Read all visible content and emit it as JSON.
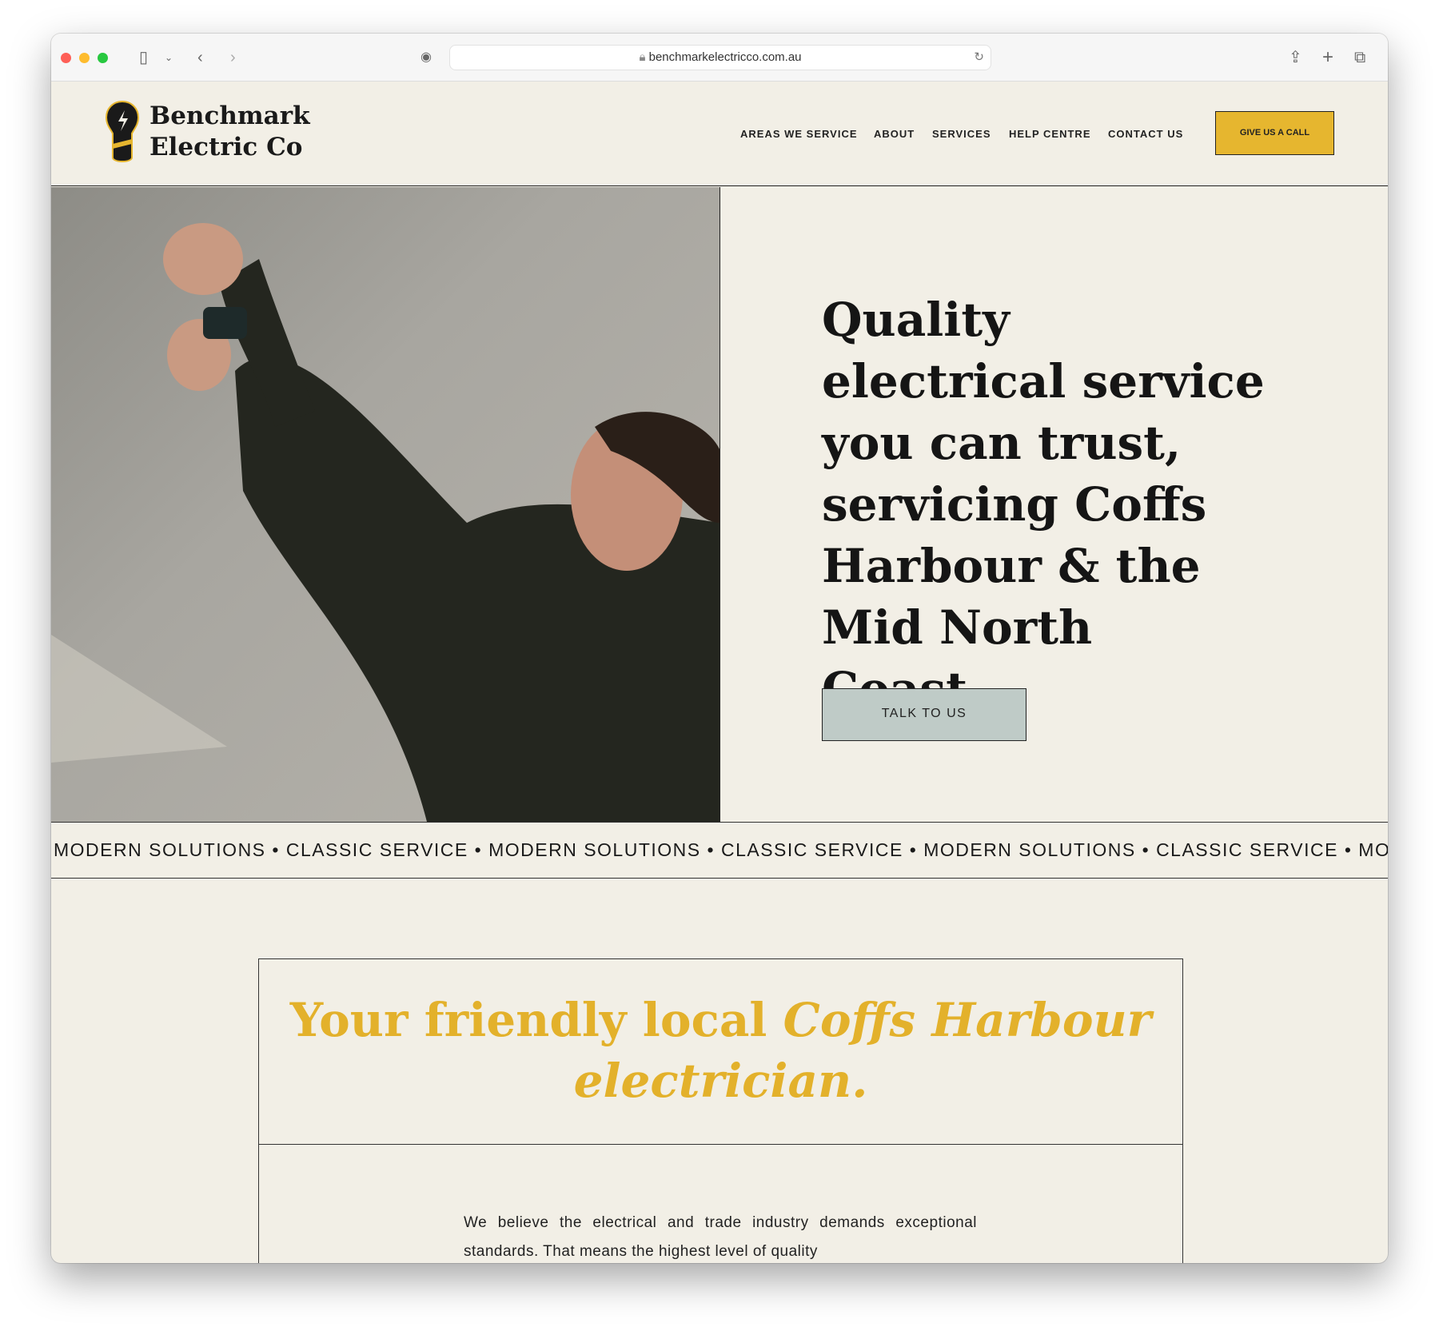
{
  "browser": {
    "url": "benchmarkelectricco.com.au"
  },
  "header": {
    "logo_line1": "Benchmark",
    "logo_line2": "Electric Co",
    "nav": [
      "AREAS WE SERVICE",
      "ABOUT",
      "SERVICES",
      "HELP CENTRE",
      "CONTACT US"
    ],
    "cta": "GIVE US A CALL"
  },
  "hero": {
    "headline": "Quality electrical service you can trust, servicing Coffs Harbour & the Mid North Coast.",
    "button": "TALK TO US"
  },
  "ticker": {
    "items": [
      "MODERN SOLUTIONS",
      "CLASSIC SERVICE",
      "MODERN SOLUTIONS",
      "CLASSIC SERVICE",
      "MODERN SOLUTIONS",
      "CLASSIC SERVICE",
      "MODERN SOLUTIONS"
    ]
  },
  "intro": {
    "title_plain": "Your friendly local ",
    "title_italic": "Coffs Harbour electrician.",
    "body": "We believe the electrical and trade industry demands exceptional standards. That means the highest level of quality"
  },
  "colors": {
    "accent": "#e6b62f",
    "background": "#f2efe6",
    "button": "#bfcbc7"
  }
}
